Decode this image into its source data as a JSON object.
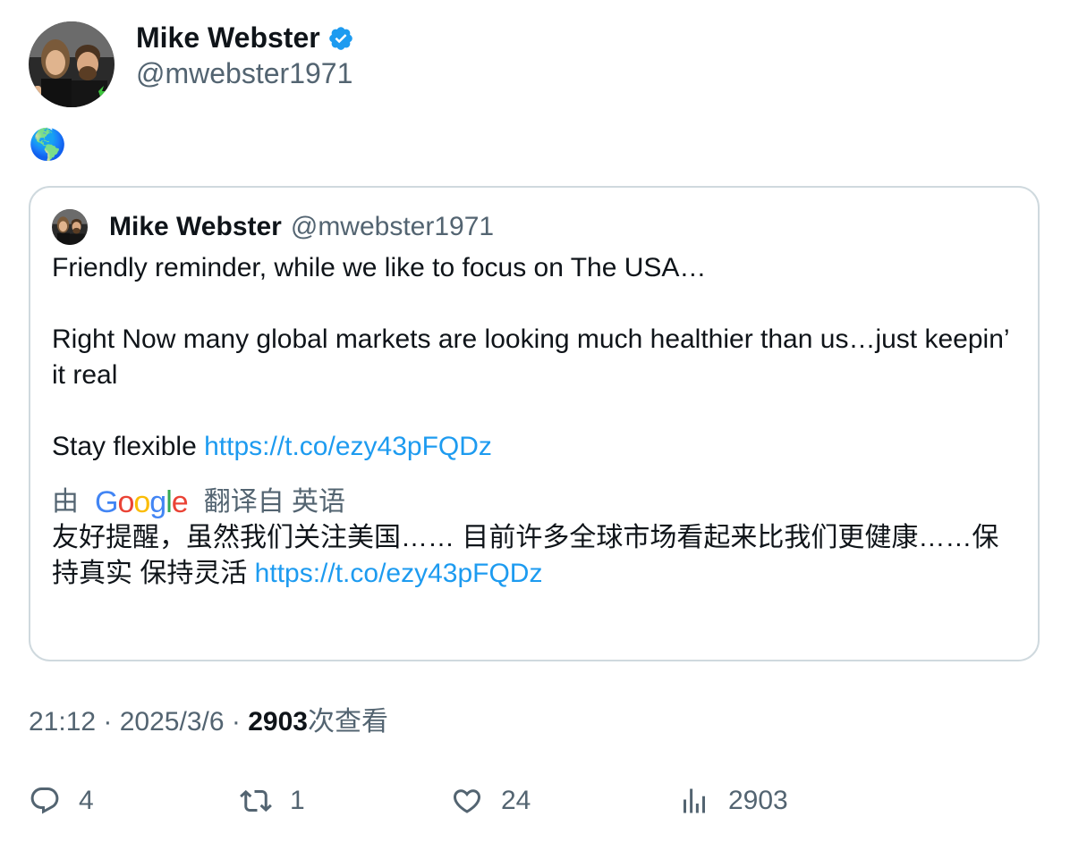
{
  "author": {
    "display_name": "Mike Webster",
    "handle": "@mwebster1971",
    "verified_icon": "verified-badge-icon"
  },
  "tweet": {
    "text": "🌎"
  },
  "quote": {
    "display_name": "Mike Webster",
    "handle": "@mwebster1971",
    "line1": "Friendly reminder, while we like to focus on The USA…",
    "line2": "Right Now many global markets are looking much healthier than us…just keepin’ it real",
    "line3_prefix": "Stay flexible ",
    "link": "https://t.co/ezy43pFQDz",
    "translate_by": "由",
    "translate_brand": "Google",
    "translate_from": "翻译自 英语",
    "translated_text": "友好提醒，虽然我们关注美国…… 目前许多全球市场看起来比我们更健康……保持真实 保持灵活 ",
    "translated_link": "https://t.co/ezy43pFQDz"
  },
  "meta": {
    "time": "21:12",
    "separator": " · ",
    "date": "2025/3/6",
    "views_count": "2903",
    "views_label": "次查看"
  },
  "actions": {
    "replies": "4",
    "retweets": "1",
    "likes": "24",
    "views": "2903"
  },
  "colors": {
    "link": "#1d9bf0",
    "secondary_text": "#536471",
    "primary_text": "#0f1419",
    "border": "#cfd9de",
    "verified": "#1d9bf0"
  }
}
